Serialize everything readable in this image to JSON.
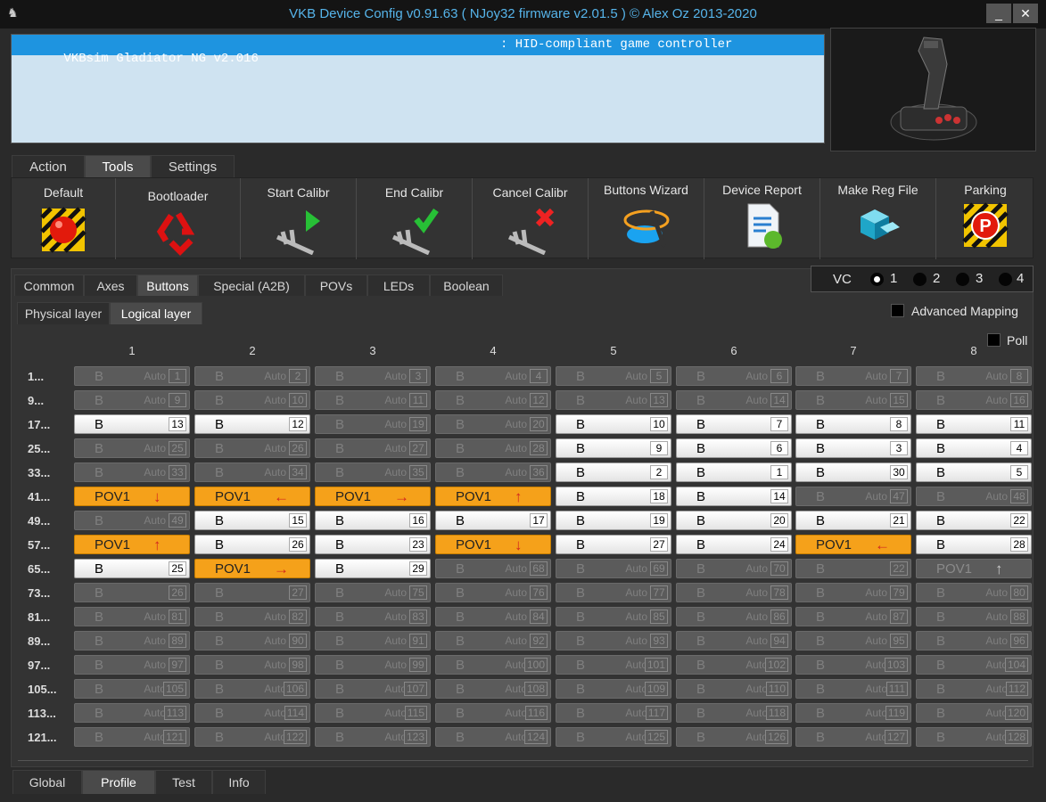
{
  "window": {
    "title": "VKB Device Config v0.91.63 ( NJoy32 firmware v2.01.5 ) © Alex Oz 2013-2020",
    "minimize": "_",
    "close": "✕"
  },
  "device": {
    "name": "VKBsim Gladiator NG v2.016",
    "type": ": HID-compliant game controller"
  },
  "main_tabs": [
    {
      "label": "Action"
    },
    {
      "label": "Tools"
    },
    {
      "label": "Settings"
    }
  ],
  "tools": [
    {
      "label": "Default",
      "icon": "red-ball-icon"
    },
    {
      "label": "Bootloader",
      "icon": "recycle-icon"
    },
    {
      "label": "Start Calibr",
      "icon": "caliper-play-icon"
    },
    {
      "label": "End Calibr",
      "icon": "caliper-check-icon"
    },
    {
      "label": "Cancel Calibr",
      "icon": "caliper-cancel-icon"
    },
    {
      "label": "Buttons Wizard",
      "icon": "wizard-icon"
    },
    {
      "label": "Device Report",
      "icon": "report-icon"
    },
    {
      "label": "Make Reg File",
      "icon": "registry-icon"
    },
    {
      "label": "Parking",
      "icon": "parking-icon"
    }
  ],
  "sub_tabs": [
    {
      "label": "Common"
    },
    {
      "label": "Axes"
    },
    {
      "label": "Buttons"
    },
    {
      "label": "Special (A2B)"
    },
    {
      "label": "POVs"
    },
    {
      "label": "LEDs"
    },
    {
      "label": "Boolean"
    }
  ],
  "vc": {
    "label": "VC",
    "options": [
      "1",
      "2",
      "3",
      "4"
    ],
    "selected": "1"
  },
  "layer_tabs": [
    {
      "label": "Physical layer"
    },
    {
      "label": "Logical layer"
    }
  ],
  "advanced_mapping": "Advanced Mapping",
  "poll": "Poll",
  "columns": [
    "1",
    "2",
    "3",
    "4",
    "5",
    "6",
    "7",
    "8"
  ],
  "rows": [
    {
      "label": "1...",
      "cells": [
        {
          "t": "d",
          "n": "1"
        },
        {
          "t": "d",
          "n": "2"
        },
        {
          "t": "d",
          "n": "3"
        },
        {
          "t": "d",
          "n": "4"
        },
        {
          "t": "d",
          "n": "5"
        },
        {
          "t": "d",
          "n": "6"
        },
        {
          "t": "d",
          "n": "7"
        },
        {
          "t": "d",
          "n": "8"
        }
      ]
    },
    {
      "label": "9...",
      "cells": [
        {
          "t": "d",
          "n": "9"
        },
        {
          "t": "d",
          "n": "10"
        },
        {
          "t": "d",
          "n": "11"
        },
        {
          "t": "d",
          "n": "12"
        },
        {
          "t": "d",
          "n": "13"
        },
        {
          "t": "d",
          "n": "14"
        },
        {
          "t": "d",
          "n": "15"
        },
        {
          "t": "d",
          "n": "16"
        }
      ]
    },
    {
      "label": "17...",
      "cells": [
        {
          "t": "b",
          "n": "13"
        },
        {
          "t": "b",
          "n": "12"
        },
        {
          "t": "d",
          "n": "19"
        },
        {
          "t": "d",
          "n": "20"
        },
        {
          "t": "b",
          "n": "10"
        },
        {
          "t": "b",
          "n": "7"
        },
        {
          "t": "b",
          "n": "8"
        },
        {
          "t": "b",
          "n": "11"
        }
      ]
    },
    {
      "label": "25...",
      "cells": [
        {
          "t": "d",
          "n": "25"
        },
        {
          "t": "d",
          "n": "26"
        },
        {
          "t": "d",
          "n": "27"
        },
        {
          "t": "d",
          "n": "28"
        },
        {
          "t": "b",
          "n": "9"
        },
        {
          "t": "b",
          "n": "6"
        },
        {
          "t": "b",
          "n": "3"
        },
        {
          "t": "b",
          "n": "4"
        }
      ]
    },
    {
      "label": "33...",
      "cells": [
        {
          "t": "d",
          "n": "33"
        },
        {
          "t": "d",
          "n": "34"
        },
        {
          "t": "d",
          "n": "35"
        },
        {
          "t": "d",
          "n": "36"
        },
        {
          "t": "b",
          "n": "2"
        },
        {
          "t": "b",
          "n": "1"
        },
        {
          "t": "b",
          "n": "30"
        },
        {
          "t": "b",
          "n": "5"
        }
      ]
    },
    {
      "label": "41...",
      "cells": [
        {
          "t": "p",
          "a": "↓"
        },
        {
          "t": "p",
          "a": "←"
        },
        {
          "t": "p",
          "a": "→"
        },
        {
          "t": "p",
          "a": "↑"
        },
        {
          "t": "b",
          "n": "18"
        },
        {
          "t": "b",
          "n": "14"
        },
        {
          "t": "d",
          "n": "47"
        },
        {
          "t": "d",
          "n": "48"
        }
      ]
    },
    {
      "label": "49...",
      "cells": [
        {
          "t": "d",
          "n": "49"
        },
        {
          "t": "b",
          "n": "15"
        },
        {
          "t": "b",
          "n": "16"
        },
        {
          "t": "b",
          "n": "17"
        },
        {
          "t": "b",
          "n": "19"
        },
        {
          "t": "b",
          "n": "20"
        },
        {
          "t": "b",
          "n": "21"
        },
        {
          "t": "b",
          "n": "22"
        }
      ]
    },
    {
      "label": "57...",
      "cells": [
        {
          "t": "p",
          "a": "↑"
        },
        {
          "t": "b",
          "n": "26"
        },
        {
          "t": "b",
          "n": "23"
        },
        {
          "t": "p",
          "a": "↓"
        },
        {
          "t": "b",
          "n": "27"
        },
        {
          "t": "b",
          "n": "24"
        },
        {
          "t": "p",
          "a": "←"
        },
        {
          "t": "b",
          "n": "28"
        }
      ]
    },
    {
      "label": "65...",
      "cells": [
        {
          "t": "b",
          "n": "25"
        },
        {
          "t": "p",
          "a": "→"
        },
        {
          "t": "b",
          "n": "29"
        },
        {
          "t": "d",
          "n": "68"
        },
        {
          "t": "d",
          "n": "69"
        },
        {
          "t": "d",
          "n": "70"
        },
        {
          "t": "x",
          "n": "22"
        },
        {
          "t": "q",
          "a": "↑"
        }
      ]
    },
    {
      "label": "73...",
      "cells": [
        {
          "t": "x",
          "n": "26"
        },
        {
          "t": "x",
          "n": "27"
        },
        {
          "t": "d",
          "n": "75"
        },
        {
          "t": "d",
          "n": "76"
        },
        {
          "t": "d",
          "n": "77"
        },
        {
          "t": "d",
          "n": "78"
        },
        {
          "t": "d",
          "n": "79"
        },
        {
          "t": "d",
          "n": "80"
        }
      ]
    },
    {
      "label": "81...",
      "cells": [
        {
          "t": "d",
          "n": "81"
        },
        {
          "t": "d",
          "n": "82"
        },
        {
          "t": "d",
          "n": "83"
        },
        {
          "t": "d",
          "n": "84"
        },
        {
          "t": "d",
          "n": "85"
        },
        {
          "t": "d",
          "n": "86"
        },
        {
          "t": "d",
          "n": "87"
        },
        {
          "t": "d",
          "n": "88"
        }
      ]
    },
    {
      "label": "89...",
      "cells": [
        {
          "t": "d",
          "n": "89"
        },
        {
          "t": "d",
          "n": "90"
        },
        {
          "t": "d",
          "n": "91"
        },
        {
          "t": "d",
          "n": "92"
        },
        {
          "t": "d",
          "n": "93"
        },
        {
          "t": "d",
          "n": "94"
        },
        {
          "t": "d",
          "n": "95"
        },
        {
          "t": "d",
          "n": "96"
        }
      ]
    },
    {
      "label": "97...",
      "cells": [
        {
          "t": "d",
          "n": "97"
        },
        {
          "t": "d",
          "n": "98"
        },
        {
          "t": "d",
          "n": "99"
        },
        {
          "t": "d",
          "n": "100"
        },
        {
          "t": "d",
          "n": "101"
        },
        {
          "t": "d",
          "n": "102"
        },
        {
          "t": "d",
          "n": "103"
        },
        {
          "t": "d",
          "n": "104"
        }
      ]
    },
    {
      "label": "105...",
      "cells": [
        {
          "t": "d",
          "n": "105"
        },
        {
          "t": "d",
          "n": "106"
        },
        {
          "t": "d",
          "n": "107"
        },
        {
          "t": "d",
          "n": "108"
        },
        {
          "t": "d",
          "n": "109"
        },
        {
          "t": "d",
          "n": "110"
        },
        {
          "t": "d",
          "n": "111"
        },
        {
          "t": "d",
          "n": "112"
        }
      ]
    },
    {
      "label": "113...",
      "cells": [
        {
          "t": "d",
          "n": "113"
        },
        {
          "t": "d",
          "n": "114"
        },
        {
          "t": "d",
          "n": "115"
        },
        {
          "t": "d",
          "n": "116"
        },
        {
          "t": "d",
          "n": "117"
        },
        {
          "t": "d",
          "n": "118"
        },
        {
          "t": "d",
          "n": "119"
        },
        {
          "t": "d",
          "n": "120"
        }
      ]
    },
    {
      "label": "121...",
      "cells": [
        {
          "t": "d",
          "n": "121"
        },
        {
          "t": "d",
          "n": "122"
        },
        {
          "t": "d",
          "n": "123"
        },
        {
          "t": "d",
          "n": "124"
        },
        {
          "t": "d",
          "n": "125"
        },
        {
          "t": "d",
          "n": "126"
        },
        {
          "t": "d",
          "n": "127"
        },
        {
          "t": "d",
          "n": "128"
        }
      ]
    }
  ],
  "cell_text": {
    "button": "B",
    "auto": "Auto",
    "pov": "POV1"
  },
  "bottom_tabs": [
    {
      "label": "Global"
    },
    {
      "label": "Profile"
    },
    {
      "label": "Test"
    },
    {
      "label": "Info"
    }
  ],
  "colors": {
    "pov": "#f5a11a",
    "title": "#56b4ea",
    "selection": "#1e94e0"
  }
}
